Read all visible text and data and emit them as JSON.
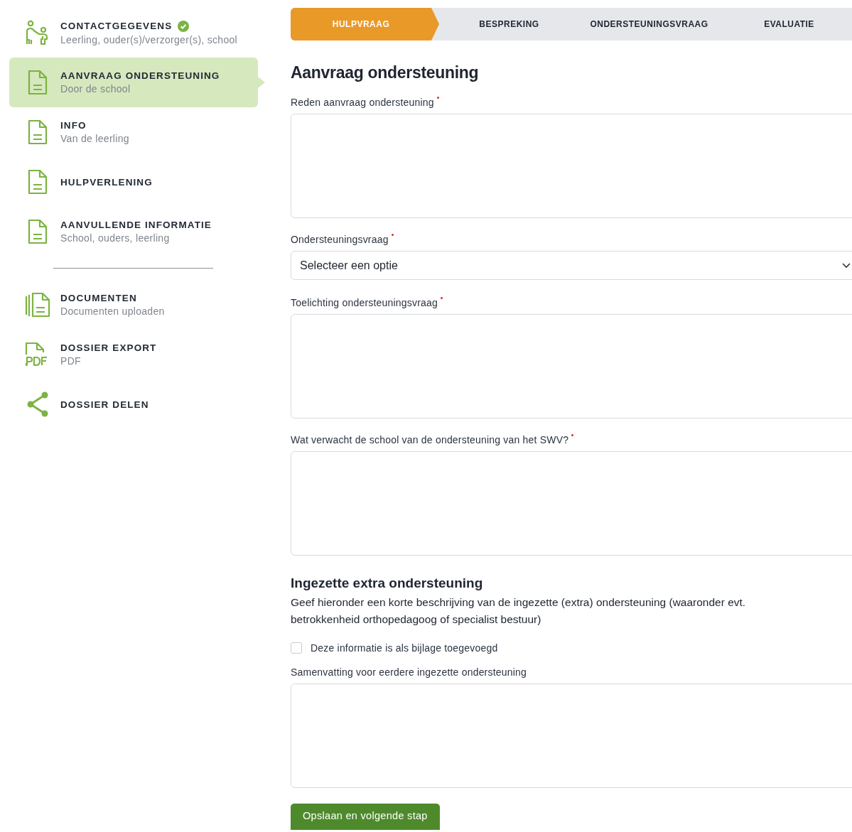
{
  "sidebar": {
    "items": [
      {
        "title": "CONTACTGEGEVENS",
        "subtitle": "Leerling, ouder(s)/verzorger(s), school",
        "kind": "people",
        "selected": false,
        "completed": true,
        "divider_after": false
      },
      {
        "title": "AANVRAAG ONDERSTEUNING",
        "subtitle": "Door de school",
        "kind": "document",
        "selected": true,
        "completed": false,
        "divider_after": false
      },
      {
        "title": "INFO",
        "subtitle": "Van de leerling",
        "kind": "document",
        "selected": false,
        "completed": false,
        "divider_after": false
      },
      {
        "title": "HULPVERLENING",
        "kind": "document",
        "selected": false,
        "completed": false,
        "divider_after": false
      },
      {
        "title": "AANVULLENDE INFORMATIE",
        "subtitle": "School, ouders, leerling",
        "kind": "document",
        "selected": false,
        "completed": false,
        "divider_after": true
      },
      {
        "title": "DOCUMENTEN",
        "subtitle": "Documenten uploaden",
        "kind": "documents",
        "selected": false,
        "completed": false,
        "divider_after": false
      },
      {
        "title": "DOSSIER EXPORT",
        "subtitle": "PDF",
        "kind": "pdf",
        "selected": false,
        "completed": false,
        "divider_after": false
      },
      {
        "title": "DOSSIER DELEN",
        "kind": "share",
        "selected": false,
        "completed": false,
        "divider_after": false
      }
    ]
  },
  "steps": [
    {
      "label": "HULPVRAAG",
      "selected": true
    },
    {
      "label": "BESPREKING",
      "selected": false
    },
    {
      "label": "ONDERSTEUNINGSVRAAG",
      "selected": false
    },
    {
      "label": "EVALUATIE",
      "selected": false
    }
  ],
  "title": "Aanvraag ondersteuning",
  "form": [
    {
      "kind": "textarea",
      "label": "Reden aanvraag ondersteuning",
      "required": true
    },
    {
      "kind": "select",
      "label": "Ondersteuningsvraag",
      "required": true,
      "value": "Selecteer een optie"
    },
    {
      "kind": "textarea",
      "label": "Toelichting ondersteuningsvraag",
      "required": true
    },
    {
      "kind": "textarea",
      "label": "Wat verwacht de school van de ondersteuning van het SWV?",
      "required": true
    },
    {
      "kind": "heading",
      "label": "Ingezette extra ondersteuning"
    },
    {
      "kind": "text",
      "label": "Geef hieronder een korte beschrijving van de ingezette (extra) ondersteuning (waaronder evt. betrokkenheid orthopedagoog of specialist bestuur)"
    },
    {
      "kind": "checkbox",
      "label": "Deze informatie is als bijlage toegevoegd",
      "checked": false
    },
    {
      "kind": "textarea",
      "label": "Samenvatting voor eerdere ingezette ondersteuning",
      "required": false
    }
  ],
  "submit": "Opslaan en volgende stap"
}
